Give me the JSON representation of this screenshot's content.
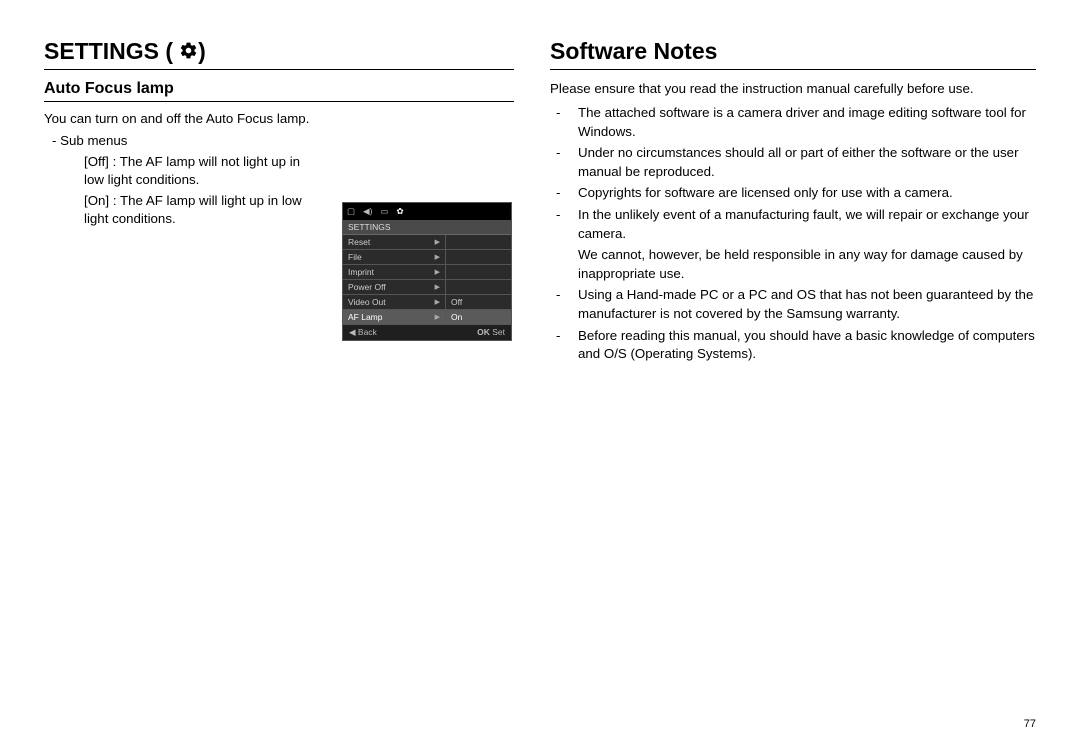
{
  "left": {
    "heading": "SETTINGS (",
    "heading_close": ")",
    "subheading": "Auto Focus lamp",
    "intro": "You can turn on and off the Auto Focus lamp.",
    "submenus_label": "Sub menus",
    "off_line": "[Off] : The AF lamp will not light up in low light conditions.",
    "on_line": "[On] : The AF lamp will light up in low light conditions.",
    "lcd": {
      "title": "SETTINGS",
      "items": [
        "Reset",
        "File",
        "Imprint",
        "Power Off",
        "Video Out",
        "AF Lamp"
      ],
      "right_off": "Off",
      "right_on": "On",
      "foot_back": "Back",
      "foot_ok": "OK",
      "foot_set": "Set"
    }
  },
  "right": {
    "heading": "Software Notes",
    "intro": "Please ensure that you read the instruction manual carefully before use.",
    "bullets": [
      "The attached software is a camera driver and image editing software tool for Windows.",
      "Under no circumstances should all or part of either the software or the user manual be reproduced.",
      "Copyrights for software are licensed only for use with a camera.",
      "In the unlikely event of a manufacturing fault, we will repair or exchange your camera.",
      "",
      "Using a Hand-made PC or a PC and OS that has not been guaranteed by the manufacturer is not covered by the Samsung warranty.",
      "Before reading this manual, you should have a basic knowledge of computers and O/S (Operating Systems)."
    ],
    "bullet4_cont": "We cannot, however, be held responsible in any way for damage caused by inappropriate use."
  },
  "page_number": "77"
}
